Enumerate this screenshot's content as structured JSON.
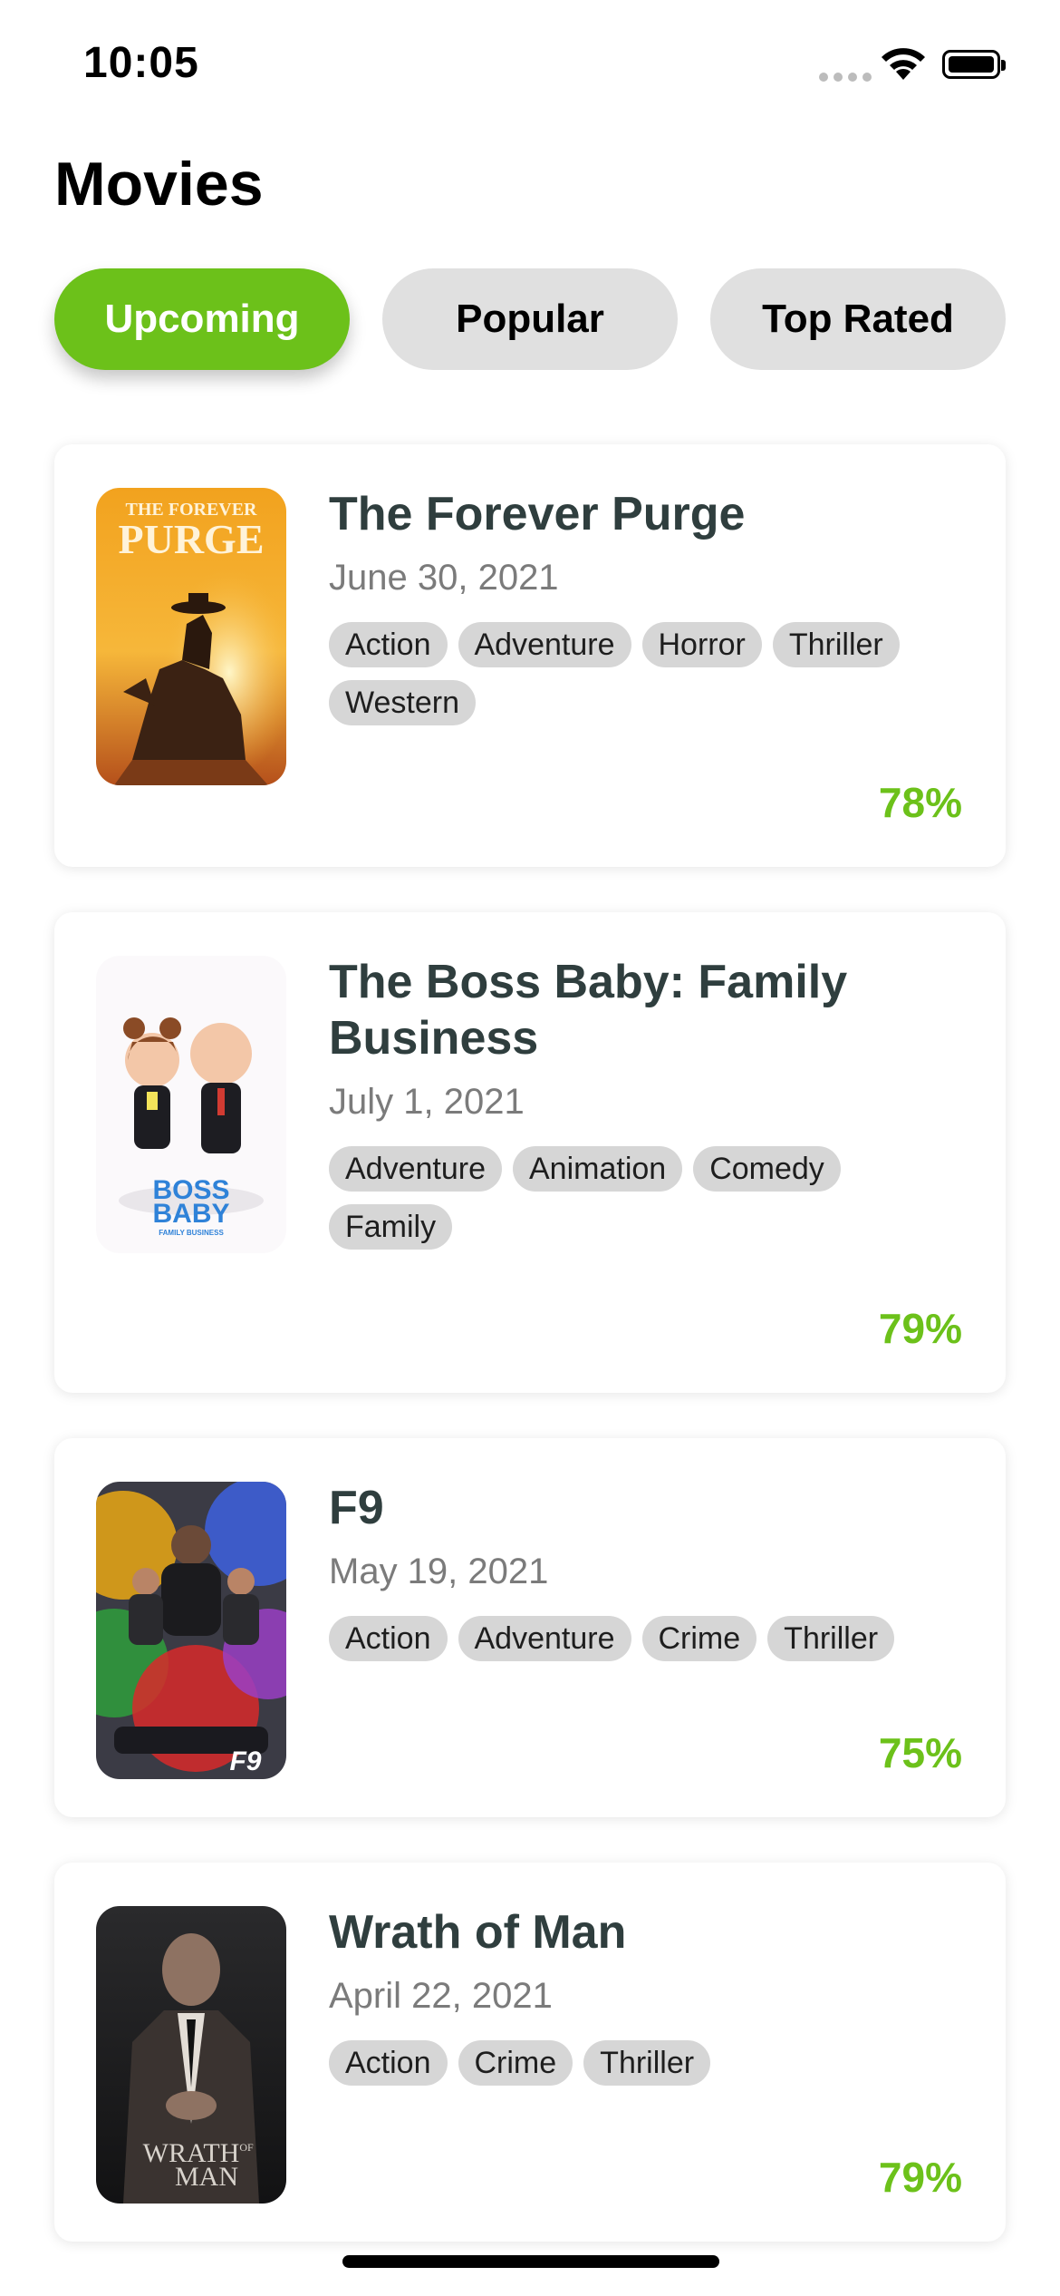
{
  "status_bar": {
    "time": "10:05",
    "signal_icon": "cellular-signal-icon",
    "wifi_icon": "wifi-icon",
    "battery_icon": "battery-icon"
  },
  "header": {
    "title": "Movies"
  },
  "tabs": [
    {
      "label": "Upcoming",
      "active": true
    },
    {
      "label": "Popular",
      "active": false
    },
    {
      "label": "Top Rated",
      "active": false
    }
  ],
  "colors": {
    "accent": "#6cc11a",
    "tab_inactive": "#e0e0e0",
    "tag_background": "#d6d6d6",
    "title_text": "#2f3e3e",
    "date_text": "#7b7b7b"
  },
  "movies": [
    {
      "title": "The Forever Purge",
      "release_date": "June 30, 2021",
      "genres": [
        "Action",
        "Adventure",
        "Horror",
        "Thriller",
        "Western"
      ],
      "rating": "78%",
      "poster_text": [
        "THE FOREVER",
        "PURGE"
      ]
    },
    {
      "title": "The Boss Baby: Family Business",
      "release_date": "July 1, 2021",
      "genres": [
        "Adventure",
        "Animation",
        "Comedy",
        "Family"
      ],
      "rating": "79%",
      "poster_text": [
        "BOSS",
        "BABY",
        "FAMILY BUSINESS"
      ]
    },
    {
      "title": "F9",
      "release_date": "May 19, 2021",
      "genres": [
        "Action",
        "Adventure",
        "Crime",
        "Thriller"
      ],
      "rating": "75%",
      "poster_text": [
        "F9"
      ]
    },
    {
      "title": "Wrath of Man",
      "release_date": "April 22, 2021",
      "genres": [
        "Action",
        "Crime",
        "Thriller"
      ],
      "rating": "79%",
      "poster_text": [
        "WRATH",
        "OF",
        "MAN"
      ]
    }
  ]
}
